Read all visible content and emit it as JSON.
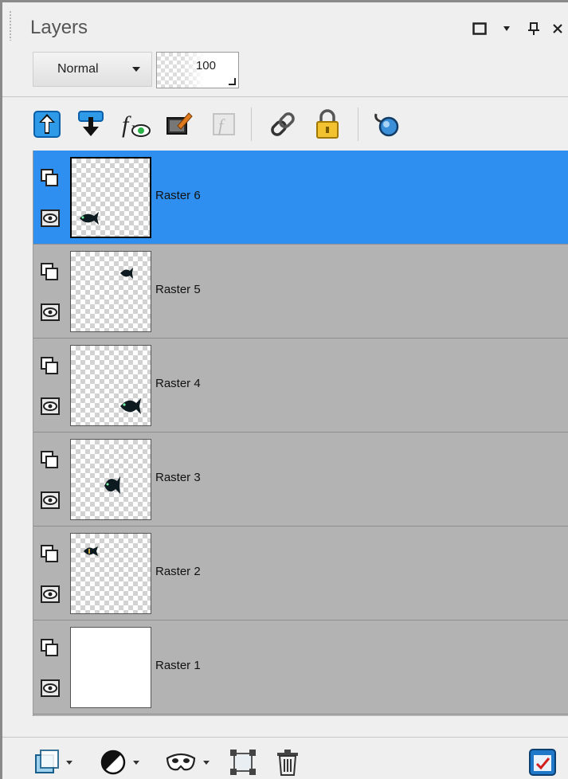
{
  "panel": {
    "title": "Layers",
    "icons": [
      "restore-icon",
      "dropdown-icon",
      "pin-icon",
      "close-icon"
    ]
  },
  "blend": {
    "mode": "Normal",
    "opacity": "100"
  },
  "toolbar": {
    "icons": [
      "move-layer-up-icon",
      "move-layer-down-icon",
      "layer-effects-icon",
      "edit-selection-icon",
      "fx-disabled-icon",
      "link-icon",
      "lock-icon",
      "pin-search-icon"
    ]
  },
  "layers": [
    {
      "name": "Raster 6",
      "selected": true
    },
    {
      "name": "Raster 5",
      "selected": false
    },
    {
      "name": "Raster 4",
      "selected": false
    },
    {
      "name": "Raster 3",
      "selected": false
    },
    {
      "name": "Raster 2",
      "selected": false
    },
    {
      "name": "Raster 1",
      "selected": false
    }
  ],
  "bottom": {
    "icons": [
      "new-raster-layer-icon",
      "new-adjustment-layer-icon",
      "new-mask-layer-icon",
      "group-layers-icon",
      "delete-layer-icon",
      "layer-properties-icon"
    ]
  },
  "colors": {
    "selected_row": "#2e8ff0",
    "row": "#b3b3b3",
    "accent": "#1a7fd6"
  }
}
